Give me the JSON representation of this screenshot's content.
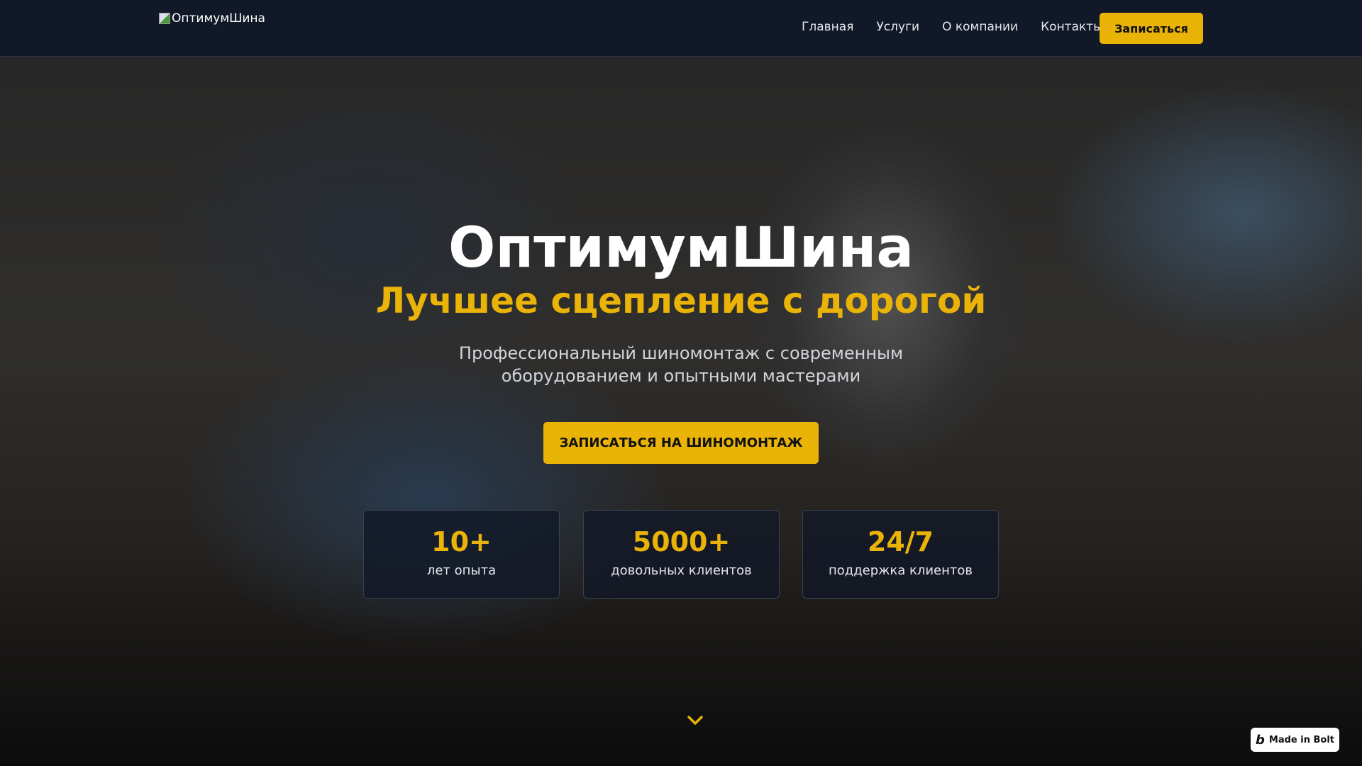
{
  "header": {
    "logo_alt": "ОптимумШина",
    "nav": [
      "Главная",
      "Услуги",
      "О компании",
      "Контакты"
    ],
    "cta": "Записаться"
  },
  "hero": {
    "title": "ОптимумШина",
    "subtitle": "Лучшее сцепление с дорогой",
    "description": "Профессиональный шиномонтаж с современным оборудованием и опытными мастерами",
    "cta": "ЗАПИСАТЬСЯ НА ШИНОМОНТАЖ"
  },
  "stats": [
    {
      "value": "10+",
      "label": "лет опыта"
    },
    {
      "value": "5000+",
      "label": "довольных клиентов"
    },
    {
      "value": "24/7",
      "label": "поддержка клиентов"
    }
  ],
  "badge": {
    "label": "Made in Bolt"
  },
  "colors": {
    "accent": "#eab308",
    "header_bg": "#111827"
  }
}
